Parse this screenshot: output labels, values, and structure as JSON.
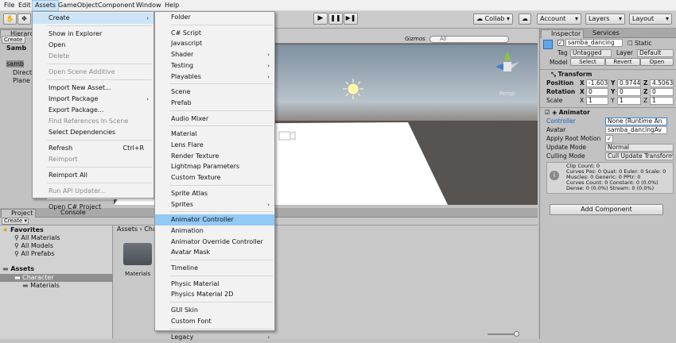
{
  "menubar": {
    "items": [
      "File",
      "Edit",
      "Assets",
      "GameObject",
      "Component",
      "Window",
      "Help"
    ]
  },
  "toolbar": {
    "collab": "Collab ▾",
    "account": "Account",
    "layers": "Layers",
    "layout": "Layout"
  },
  "hierarchy": {
    "tab": "Hierarch",
    "create": "Create",
    "items": [
      "Samb",
      "samb",
      "Directi",
      "Plane"
    ]
  },
  "scene": {
    "gizmos": "Gizmos",
    "search_placeholder": "All",
    "persp": "Persp"
  },
  "project": {
    "tab_project": "Project",
    "tab_console": "Console",
    "create": "Create",
    "favorites": "Favorites",
    "fav_items": [
      "All Materials",
      "All Models",
      "All Prefabs"
    ],
    "assets": "Assets",
    "asset_items": [
      "Character",
      "Materials"
    ],
    "breadcrumb": "Assets",
    "breadcrumb2": "Cha",
    "folder_label": "Materials"
  },
  "assets_menu": {
    "items": [
      {
        "label": "Create",
        "arrow": "›",
        "state": "highlighted"
      },
      {
        "label": "Show in Explorer"
      },
      {
        "label": "Open"
      },
      {
        "label": "Delete",
        "state": "disabled"
      },
      {
        "label": "Open Scene Additive",
        "state": "disabled"
      },
      {
        "label": "Import New Asset..."
      },
      {
        "label": "Import Package",
        "arrow": "›"
      },
      {
        "label": "Export Package..."
      },
      {
        "label": "Find References In Scene",
        "state": "disabled"
      },
      {
        "label": "Select Dependencies"
      },
      {
        "label": "Refresh",
        "shortcut": "Ctrl+R"
      },
      {
        "label": "Reimport",
        "state": "disabled"
      },
      {
        "label": "Reimport All"
      },
      {
        "label": "Run API Updater...",
        "state": "disabled"
      },
      {
        "label": "Open C# Project"
      }
    ]
  },
  "create_menu": {
    "items": [
      {
        "label": "Folder"
      },
      {
        "label": "C# Script"
      },
      {
        "label": "Javascript"
      },
      {
        "label": "Shader",
        "arrow": "›"
      },
      {
        "label": "Testing",
        "arrow": "›"
      },
      {
        "label": "Playables",
        "arrow": "›"
      },
      {
        "label": "Scene"
      },
      {
        "label": "Prefab"
      },
      {
        "label": "Audio Mixer"
      },
      {
        "label": "Material"
      },
      {
        "label": "Lens Flare"
      },
      {
        "label": "Render Texture"
      },
      {
        "label": "Lightmap Parameters"
      },
      {
        "label": "Custom Texture"
      },
      {
        "label": "Sprite Atlas"
      },
      {
        "label": "Sprites",
        "arrow": "›"
      },
      {
        "label": "Animator Controller",
        "state": "highlighted"
      },
      {
        "label": "Animation"
      },
      {
        "label": "Animator Override Controller"
      },
      {
        "label": "Avatar Mask"
      },
      {
        "label": "Timeline"
      },
      {
        "label": "Physic Material"
      },
      {
        "label": "Physics Material 2D"
      },
      {
        "label": "GUI Skin"
      },
      {
        "label": "Custom Font"
      },
      {
        "label": "Legacy",
        "arrow": "›"
      }
    ]
  },
  "inspector": {
    "tab": "Inspector",
    "tab2": "Services",
    "object_name": "samba_dancing",
    "static": "Static",
    "tag_label": "Tag",
    "tag_value": "Untagged",
    "layer_label": "Layer",
    "layer_value": "Default",
    "model_label": "Model",
    "model_buttons": [
      "Select",
      "Revert",
      "Open"
    ],
    "transform": {
      "title": "Transform",
      "rows": [
        {
          "label": "Position",
          "x": "-1.603",
          "y": "0.9744",
          "z": "4.5063"
        },
        {
          "label": "Rotation",
          "x": "0",
          "y": "0",
          "z": "0"
        },
        {
          "label": "Scale",
          "x": "1",
          "y": "1",
          "z": "1"
        }
      ]
    },
    "animator": {
      "title": "Animator",
      "rows": [
        {
          "label": "Controller",
          "value": "None (Runtime An"
        },
        {
          "label": "Avatar",
          "value": "samba_dancingAv"
        },
        {
          "label": "Apply Root Motion",
          "value": "✓"
        },
        {
          "label": "Update Mode",
          "value": "Normal"
        },
        {
          "label": "Culling Mode",
          "value": "Cull Update Transforms"
        }
      ],
      "info": [
        "Clip Count: 0",
        "Curves Pos: 0 Quat: 0 Euler: 0 Scale: 0",
        "Muscles: 0 Generic: 0 PPtr: 0",
        "Curves Count: 0 Constant: 0 (0.0%)",
        "Dense: 0 (0.0%) Stream: 0 (0.0%)"
      ]
    },
    "add_component": "Add Component"
  }
}
